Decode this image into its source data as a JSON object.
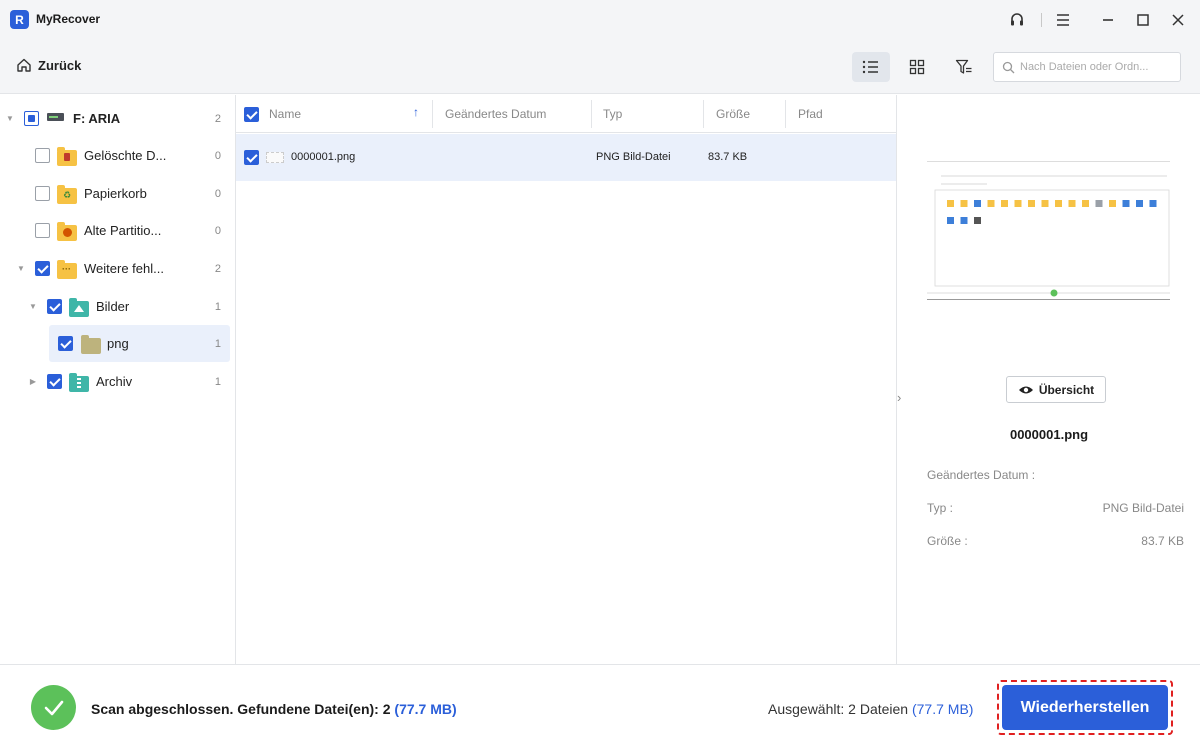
{
  "app": {
    "title": "MyRecover",
    "logo_glyph": "R"
  },
  "toolbar": {
    "back_label": "Zurück",
    "search_placeholder": "Nach Dateien oder Ordn..."
  },
  "tree": [
    {
      "label": "F: ARIA",
      "count": "2"
    },
    {
      "label": "Gelöschte D...",
      "count": "0"
    },
    {
      "label": "Papierkorb",
      "count": "0"
    },
    {
      "label": "Alte Partitio...",
      "count": "0"
    },
    {
      "label": "Weitere fehl...",
      "count": "2"
    },
    {
      "label": "Bilder",
      "count": "1"
    },
    {
      "label": "png",
      "count": "1"
    },
    {
      "label": "Archiv",
      "count": "1"
    }
  ],
  "list": {
    "columns": [
      "Name",
      "Geändertes Datum",
      "Typ",
      "Größe",
      "Pfad"
    ],
    "rows": [
      {
        "name": "0000001.png",
        "date": "",
        "type": "PNG Bild-Datei",
        "size": "83.7 KB",
        "path": ""
      }
    ]
  },
  "preview": {
    "overview_label": "Übersicht",
    "file_name": "0000001.png",
    "fields": [
      {
        "key": "Geändertes Datum :",
        "value": ""
      },
      {
        "key": "Typ :",
        "value": "PNG Bild-Datei"
      },
      {
        "key": "Größe :",
        "value": "83.7 KB"
      }
    ]
  },
  "footer": {
    "scan_text": "Scan abgeschlossen. Gefundene Datei(en): 2",
    "scan_size": "(77.7 MB)",
    "selected_text": "Ausgewählt: 2 Dateien",
    "selected_size": "(77.7 MB)",
    "recover_label": "Wiederherstellen"
  },
  "colors": {
    "accent": "#2b5fd9",
    "success": "#5cc15a",
    "highlight_outline": "#e02020",
    "folder": "#f6c244"
  }
}
